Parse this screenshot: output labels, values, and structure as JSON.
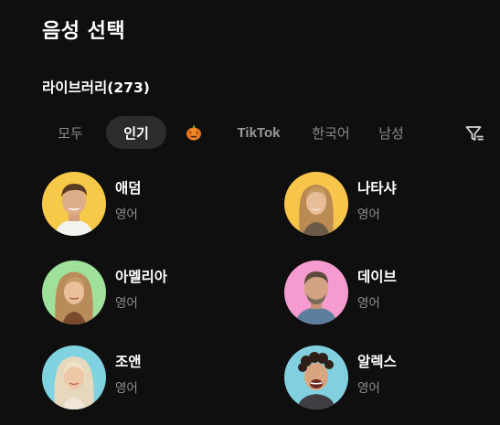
{
  "header": {
    "title": "음성 선택"
  },
  "library": {
    "label": "라이브러리(273)"
  },
  "tabs": [
    {
      "label": "모두",
      "active": false
    },
    {
      "label": "인기",
      "active": true
    },
    {
      "label": "",
      "icon": "pumpkin-icon"
    },
    {
      "label": "TikTok",
      "active": false
    },
    {
      "label": "한국어",
      "active": false
    },
    {
      "label": "남성",
      "active": false
    }
  ],
  "filter": {
    "icon": "filter-icon"
  },
  "voices": [
    {
      "name": "애덤",
      "lang": "영어",
      "bg": "#f7c948"
    },
    {
      "name": "나타샤",
      "lang": "영어",
      "bg": "#f6c54a"
    },
    {
      "name": "아멜리아",
      "lang": "영어",
      "bg": "#9fe09a"
    },
    {
      "name": "데이브",
      "lang": "영어",
      "bg": "#f59bcf"
    },
    {
      "name": "조앤",
      "lang": "영어",
      "bg": "#7fd3e0"
    },
    {
      "name": "알렉스",
      "lang": "영어",
      "bg": "#82d0df"
    }
  ]
}
